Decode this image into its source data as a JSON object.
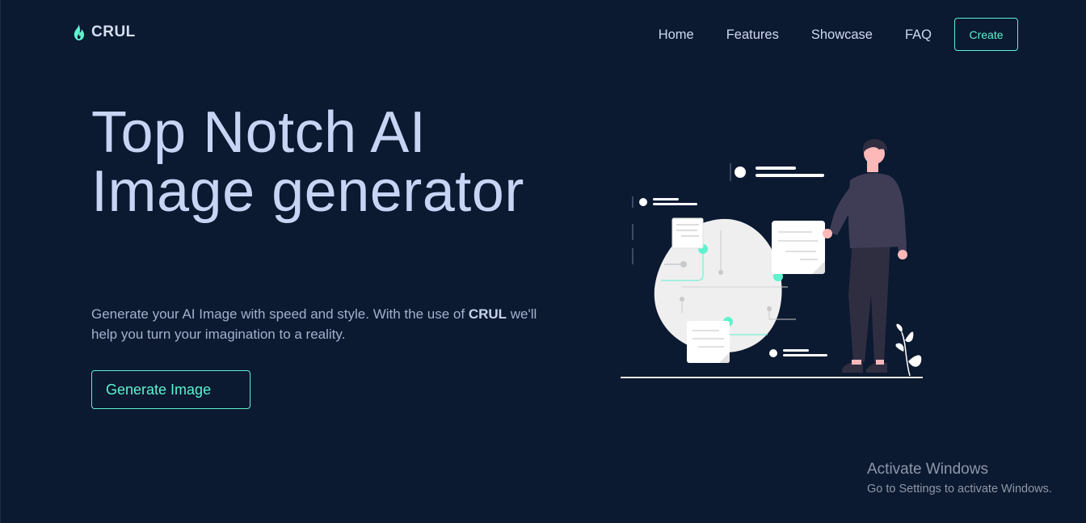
{
  "brand": {
    "name": "CRUL",
    "icon": "flame-icon",
    "accent": "#5ef2cf"
  },
  "nav": {
    "items": [
      "Home",
      "Features",
      "Showcase",
      "FAQ"
    ],
    "cta": "Create"
  },
  "hero": {
    "title": "Top Notch AI Image generator",
    "subtitle_before": "Generate your AI Image with speed and style. With the use of ",
    "subtitle_brand": "CRUL",
    "subtitle_after": " we'll help you turn your imagination to a reality.",
    "button": "Generate Image"
  },
  "illustration": {
    "name": "person-with-floating-cards-illustration"
  },
  "watermark": {
    "title": "Activate Windows",
    "subtitle": "Go to Settings to activate Windows."
  },
  "colors": {
    "background": "#0b1931",
    "accent": "#5ef2cf",
    "heading": "#c8d4f4"
  }
}
